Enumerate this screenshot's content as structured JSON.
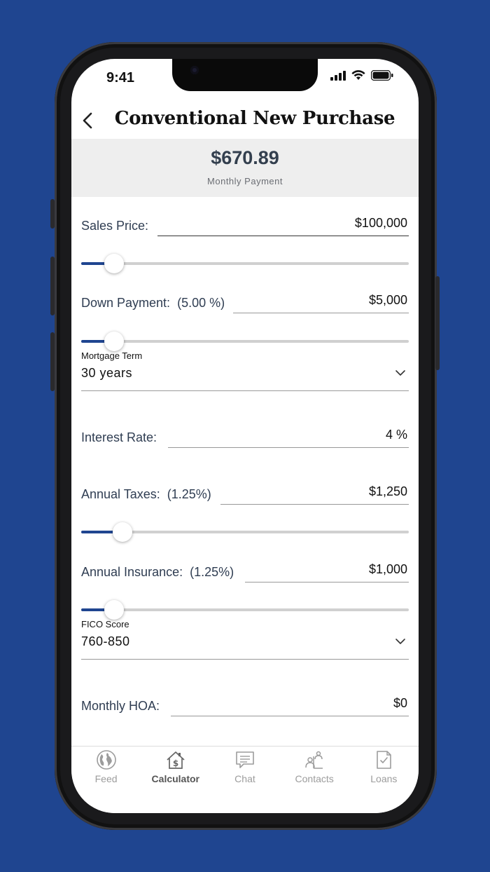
{
  "status_bar": {
    "time": "9:41"
  },
  "nav": {
    "title": "Conventional New Purchase"
  },
  "summary": {
    "amount": "$670.89",
    "label": "Monthly Payment"
  },
  "fields": {
    "sales_price": {
      "label": "Sales Price:",
      "value": "$100,000",
      "slider_fraction": 0.1
    },
    "down_payment": {
      "label": "Down Payment:",
      "percent": "(5.00 %)",
      "value": "$5,000",
      "slider_fraction": 0.1
    },
    "mortgage_term": {
      "caption": "Mortgage Term",
      "value": "30 years"
    },
    "interest_rate": {
      "label": "Interest Rate:",
      "value": "4 %"
    },
    "annual_taxes": {
      "label": "Annual Taxes:",
      "percent": "(1.25%)",
      "value": "$1,250",
      "slider_fraction": 0.125
    },
    "annual_insurance": {
      "label": "Annual Insurance:",
      "percent": "(1.25%)",
      "value": "$1,000",
      "slider_fraction": 0.1
    },
    "fico_score": {
      "caption": "FICO Score",
      "value": "760-850"
    },
    "monthly_hoa": {
      "label": "Monthly HOA:",
      "value": "$0"
    }
  },
  "tabs": [
    {
      "label": "Feed",
      "icon": "globe-icon"
    },
    {
      "label": "Calculator",
      "icon": "house-dollar-icon",
      "active": true
    },
    {
      "label": "Chat",
      "icon": "chat-icon"
    },
    {
      "label": "Contacts",
      "icon": "contacts-icon"
    },
    {
      "label": "Loans",
      "icon": "document-check-icon"
    }
  ],
  "colors": {
    "background": "#1f4590",
    "accent": "#1f4590",
    "summary_bg": "#eeeeee",
    "amount_text": "#333f4e"
  }
}
